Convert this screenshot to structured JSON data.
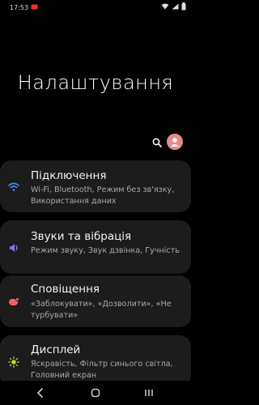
{
  "status_bar": {
    "time": "17:53",
    "icons": [
      "notification-icon",
      "wifi-icon",
      "signal-icon",
      "battery-icon"
    ]
  },
  "header": {
    "title": "Налаштування",
    "search_icon": "search-icon",
    "avatar_icon": "profile-avatar-icon"
  },
  "settings": [
    {
      "title": "Підключення",
      "subtitle": "Wi-Fi, Bluetooth, Режим без зв'язку, Використання даних",
      "icon": "wifi-icon",
      "icon_color": "#4a83ff"
    },
    {
      "title": "Звуки та вібрація",
      "subtitle": "Режим звуку, Звук дзвінка, Гучність",
      "icon": "speaker-icon",
      "icon_color": "#8a6cf0"
    },
    {
      "title": "Сповіщення",
      "subtitle": "«Заблокувати», «Дозволити», «Не турбувати»",
      "icon": "notification-bubble-icon",
      "icon_color": "#f06262"
    },
    {
      "title": "Дисплей",
      "subtitle": "Яскравість, Фільтр синього світла, Головний екран",
      "icon": "brightness-icon",
      "icon_color": "#c7d230"
    }
  ],
  "nav_bar": {
    "back_icon": "back-icon",
    "home_icon": "home-icon",
    "recents_icon": "recents-icon"
  }
}
